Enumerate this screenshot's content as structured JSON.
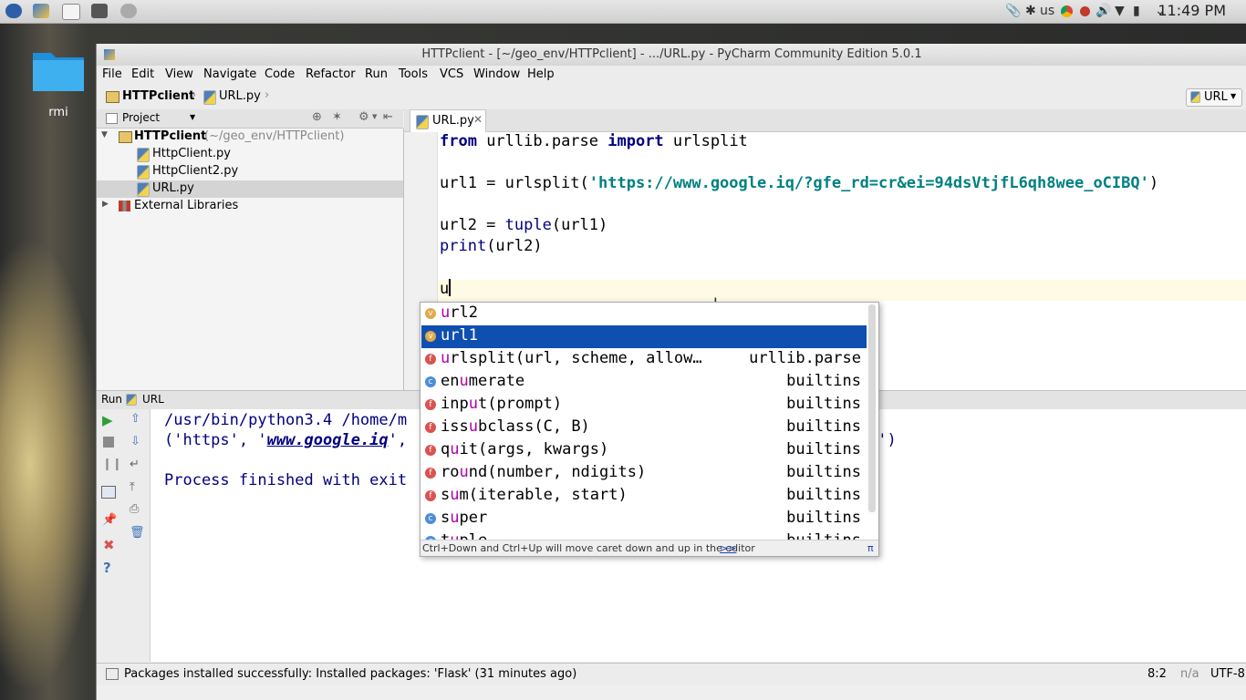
{
  "desktop": {
    "folder_label": "rmi",
    "clock": "11:49 PM",
    "keyboard_layout": "us"
  },
  "window": {
    "title": "HTTPclient - [~/geo_env/HTTPclient] - .../URL.py - PyCharm Community Edition 5.0.1"
  },
  "menu": [
    "File",
    "Edit",
    "View",
    "Navigate",
    "Code",
    "Refactor",
    "Run",
    "Tools",
    "VCS",
    "Window",
    "Help"
  ],
  "breadcrumb": {
    "project": "HTTPclient",
    "file": "URL.py",
    "run_config": "URL"
  },
  "project_panel": {
    "title": "Project",
    "root": "HTTPclient",
    "root_path": "(~/geo_env/HTTPclient)",
    "files": [
      "HttpClient.py",
      "HttpClient2.py",
      "URL.py"
    ],
    "external": "External Libraries"
  },
  "editor": {
    "tab": "URL.py",
    "lines": {
      "l1_kw1": "from",
      "l1_mid": " urllib.parse ",
      "l1_kw2": "import",
      "l1_end": " urlsplit",
      "l3_start": "url1 = urlsplit(",
      "l3_str": "'https://www.google.iq/?gfe_rd=cr&ei=94dsVtjfL6qh8wee_oCIBQ'",
      "l3_end": ")",
      "l5_start": "url2 = ",
      "l5_bi": "tuple",
      "l5_end": "(url1)",
      "l6_bi": "print",
      "l6_end": "(url2)",
      "l8": "u"
    }
  },
  "completion": {
    "items": [
      {
        "kind": "v",
        "pre": "",
        "hl": "u",
        "post": "rl2",
        "src": ""
      },
      {
        "kind": "v",
        "pre": "",
        "hl": "u",
        "post": "rl1",
        "src": ""
      },
      {
        "kind": "f",
        "pre": "",
        "hl": "u",
        "post": "rlsplit(url, scheme, allow…",
        "src": "urllib.parse"
      },
      {
        "kind": "c",
        "pre": "en",
        "hl": "u",
        "post": "merate",
        "src": "builtins"
      },
      {
        "kind": "f",
        "pre": "inp",
        "hl": "u",
        "post": "t(prompt)",
        "src": "builtins"
      },
      {
        "kind": "f",
        "pre": "iss",
        "hl": "u",
        "post": "bclass(C, B)",
        "src": "builtins"
      },
      {
        "kind": "f",
        "pre": "q",
        "hl": "u",
        "post": "it(args, kwargs)",
        "src": "builtins"
      },
      {
        "kind": "f",
        "pre": "ro",
        "hl": "u",
        "post": "nd(number, ndigits)",
        "src": "builtins"
      },
      {
        "kind": "f",
        "pre": "s",
        "hl": "u",
        "post": "m(iterable, start)",
        "src": "builtins"
      },
      {
        "kind": "c",
        "pre": "s",
        "hl": "u",
        "post": "per",
        "src": "builtins"
      },
      {
        "kind": "c",
        "pre": "t",
        "hl": "u",
        "post": "ple",
        "src": "builtins"
      }
    ],
    "footer": "Ctrl+Down and Ctrl+Up will move caret down and up in the editor",
    "footer_link": ">>",
    "footer_icon": "π"
  },
  "run": {
    "label": "Run",
    "config": "URL",
    "line1": "/usr/bin/python3.4 /home/m",
    "line2_start": "('https', '",
    "line2_link": "www.google.iq",
    "line2_end": "',",
    "line2_tail": "'')",
    "line3": "Process finished with exit"
  },
  "status": {
    "message": "Packages installed successfully: Installed packages: 'Flask' (31 minutes ago)",
    "position": "8:2",
    "na": "n/a",
    "encoding": "UTF-8"
  }
}
